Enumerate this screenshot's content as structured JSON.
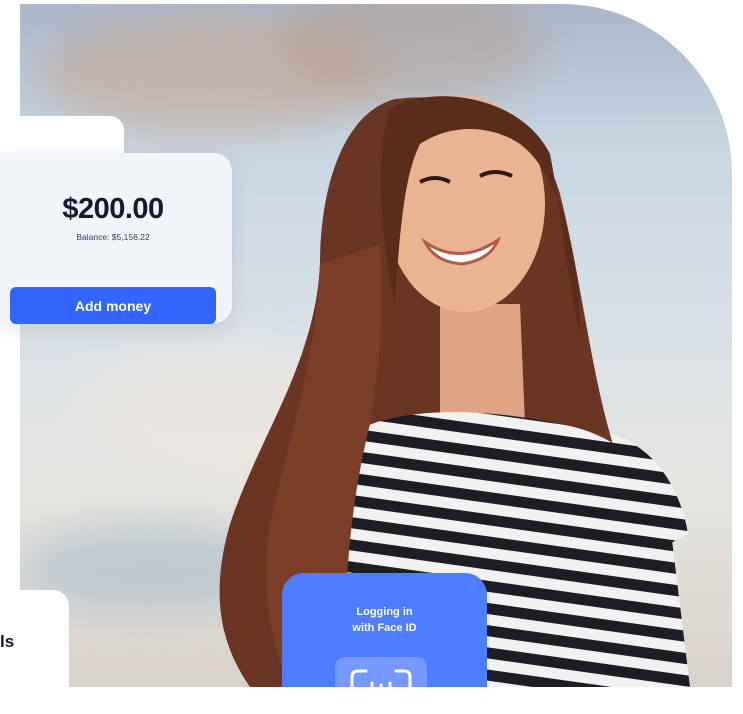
{
  "transfer": {
    "amount": "$200.00",
    "balance": "Balance: $5,156.22",
    "add_button": "Add money"
  },
  "bottom_card": {
    "text_fragment": "ls"
  },
  "faceid": {
    "line1": "Logging in",
    "line2": "with Face ID",
    "icon": "face-id-icon"
  },
  "colors": {
    "accent": "#3366ff",
    "faceid_card": "#4f7dff",
    "card_bg": "#f1f5f9",
    "text_dark": "#121a33"
  }
}
